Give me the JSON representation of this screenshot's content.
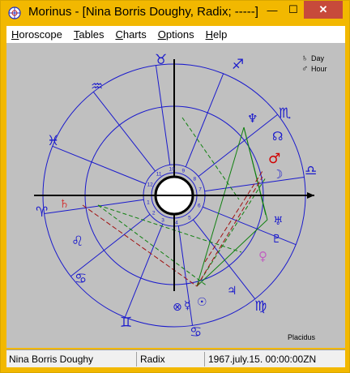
{
  "window": {
    "title": "Morinus - [Nina Borris Doughy, Radix; -----]",
    "minimize_symbol": "—",
    "maximize_symbol": "☐",
    "close_symbol": "✕"
  },
  "menu": [
    "Horoscope",
    "Tables",
    "Charts",
    "Options",
    "Help"
  ],
  "chart": {
    "legend_day": "Day",
    "legend_hour": "Hour",
    "legend_day_symbol": "♄",
    "legend_hour_symbol": "♂",
    "house_system": "Placidus",
    "house_numbers": [
      "1",
      "2",
      "3",
      "4",
      "5",
      "6",
      "7",
      "8",
      "9",
      "10",
      "11",
      "12"
    ],
    "zodiac_symbols": [
      "♉",
      "♈",
      "♓",
      "♒",
      "♑",
      "♐",
      "♏",
      "♎",
      "♍",
      "♌",
      "♋",
      "♊"
    ],
    "planet_symbols": {
      "neptune": "♆",
      "mars": "♂",
      "moon": "☽",
      "uranus": "♅",
      "pluto": "♇",
      "venus": "♀",
      "jupiter": "♃",
      "sun": "☉",
      "mercury": "☿",
      "node": "☊",
      "saturn": "♄",
      "fortune": "⊗"
    },
    "colors": {
      "background": "#c0c0c0",
      "signs": "#1a1acc",
      "circles": "#1a1acc",
      "axes": "#000000",
      "aspect_green": "#108010",
      "aspect_red": "#a01010",
      "mars": "#d00000",
      "venus": "#c060c0",
      "saturn": "#d04040"
    }
  },
  "status": {
    "name": "Nina Borris Doughy",
    "type": "Radix",
    "datetime": "1967.july.15. 00:00:00ZN"
  }
}
